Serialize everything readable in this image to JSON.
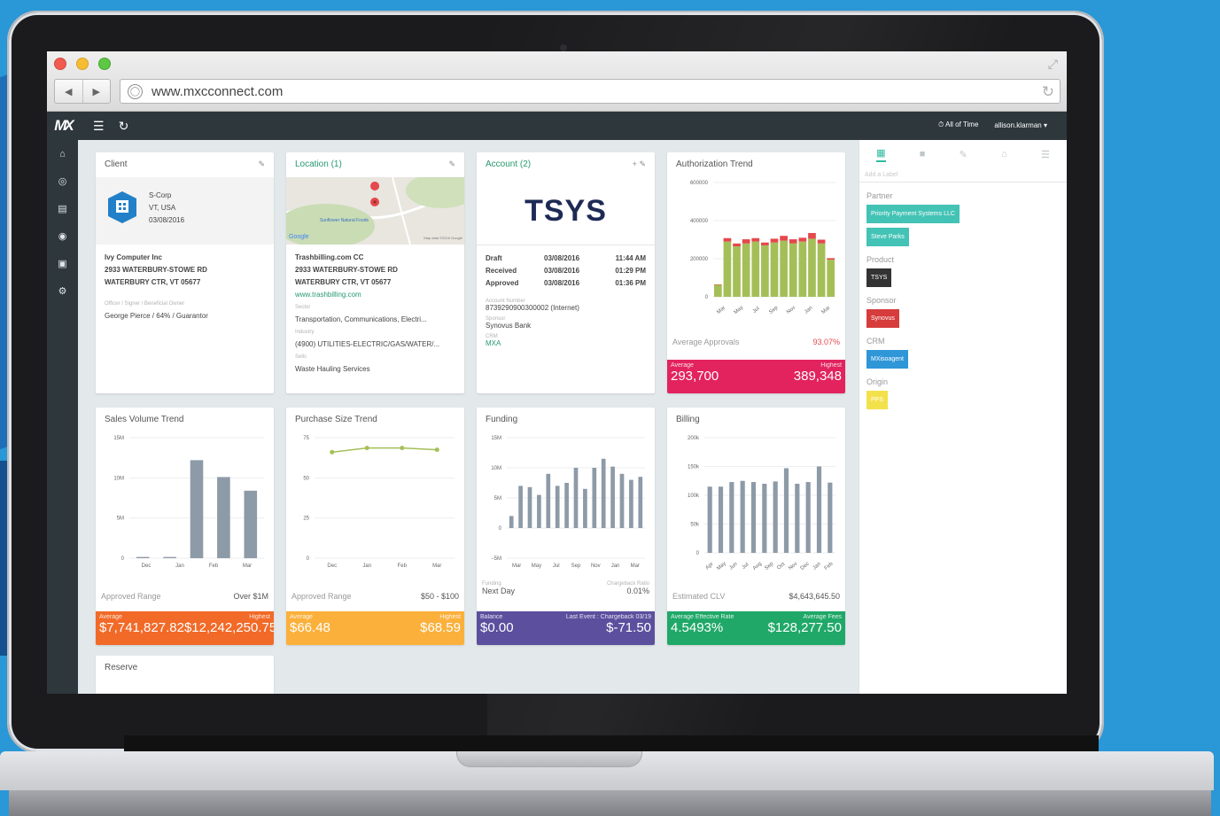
{
  "browser": {
    "url": "www.mxcconnect.com"
  },
  "topbar": {
    "logo": "MX",
    "time_filter": "All of Time",
    "user": "allison.klarman"
  },
  "client": {
    "title": "Client",
    "entity_type": "S-Corp",
    "state": "VT, USA",
    "date": "03/08/2016",
    "company": "Ivy Computer Inc",
    "address1": "2933 WATERBURY-STOWE RD",
    "address2": "WATERBURY CTR, VT 05677",
    "officer_label": "Officer / Signer / Beneficial Owner",
    "officer_value": "George Pierce / 64% / Guarantor"
  },
  "location": {
    "title": "Location (1)",
    "map_place": "Sunflower Natural Foods",
    "map_brand": "Google",
    "map_credit": "Map data ©2016 Google",
    "name": "Trashbilling.com CC",
    "address1": "2933 WATERBURY-STOWE RD",
    "address2": "WATERBURY CTR, VT 05677",
    "website": "www.trashbilling.com",
    "sector_label": "Sector",
    "sector": "Transportation, Communications, Electri...",
    "industry_label": "Industry",
    "industry": "(4900) UTILITIES-ELECTRIC/GAS/WATER/...",
    "sells_label": "Sells",
    "sells": "Waste Hauling Services"
  },
  "account": {
    "title": "Account (2)",
    "brand": "TSYS",
    "rows": [
      {
        "status": "Draft",
        "date": "03/08/2016",
        "time": "11:44 AM"
      },
      {
        "status": "Received",
        "date": "03/08/2016",
        "time": "01:29 PM"
      },
      {
        "status": "Approved",
        "date": "03/08/2016",
        "time": "01:36 PM"
      }
    ],
    "acct_label": "Account Number",
    "acct": "8739290900300002 (Internet)",
    "sponsor_label": "Sponsor",
    "sponsor": "Synovus Bank",
    "crm_label": "CRM",
    "crm": "MXA"
  },
  "auth": {
    "title": "Authorization Trend",
    "stat_label": "Average Approvals",
    "stat_value": "93.07%",
    "avg_label": "Average",
    "avg": "293,700",
    "high_label": "Highest",
    "high": "389,348"
  },
  "sales": {
    "title": "Sales Volume Trend",
    "stat_label": "Approved Range",
    "stat_value": "Over $1M",
    "avg_label": "Average",
    "avg": "$7,741,827.82",
    "high_label": "Highest",
    "high": "$12,242,250.75"
  },
  "purchase": {
    "title": "Purchase Size Trend",
    "stat_label": "Approved Range",
    "stat_value": "$50 - $100",
    "avg_label": "Average",
    "avg": "$66.48",
    "high_label": "Highest",
    "high": "$68.59"
  },
  "funding": {
    "title": "Funding",
    "funding_label": "Funding",
    "funding_value": "Next Day",
    "cb_label": "Chargeback Ratio",
    "cb_value": "0.01%",
    "balance_label": "Balance",
    "balance": "$0.00",
    "event_label": "Last Event : Chargeback 03/19",
    "event": "$-71.50"
  },
  "billing": {
    "title": "Billing",
    "stat_label": "Estimated CLV",
    "stat_value": "$4,643,645.50",
    "rate_label": "Average Effective Rate",
    "rate": "4.5493%",
    "fees_label": "Average Fees",
    "fees": "$128,277.50"
  },
  "reserve": {
    "title": "Reserve"
  },
  "right_panel": {
    "add_label": "Add a Label",
    "sections": [
      {
        "title": "Partner",
        "tags": [
          "Priority Payment Systems LLC",
          "Steve Parks"
        ]
      },
      {
        "title": "Product",
        "tags": [
          "TSYS"
        ]
      },
      {
        "title": "Sponsor",
        "tags": [
          "Synovus"
        ]
      },
      {
        "title": "CRM",
        "tags": [
          "MXisoagent"
        ]
      },
      {
        "title": "Origin",
        "tags": [
          "PPS"
        ]
      }
    ]
  },
  "colors": {
    "accent_green": "#26996f",
    "auth_footer": "#e2235e",
    "sales_footer": "#f16a28",
    "purchase_footer": "#fbb03b",
    "funding_footer": "#5b4f9e",
    "billing_footer": "#20a868",
    "bar_grey": "#8d9aa7",
    "bar_green": "#a4bf58",
    "bar_red": "#e5484d"
  },
  "chart_data": [
    {
      "type": "bar",
      "title": "Authorization Trend",
      "categories": [
        "Mar",
        "Apr",
        "May",
        "Jun",
        "Jul",
        "Aug",
        "Sep",
        "Oct",
        "Nov",
        "Dec",
        "Jan",
        "Feb",
        "Mar"
      ],
      "x_tick_labels": [
        "Mar",
        "May",
        "Jul",
        "Sep",
        "Nov",
        "Jan",
        "Mar"
      ],
      "series": [
        {
          "name": "Approved",
          "values": [
            65000,
            290000,
            265000,
            280000,
            290000,
            270000,
            285000,
            295000,
            280000,
            290000,
            305000,
            280000,
            195000
          ]
        },
        {
          "name": "Declined",
          "values": [
            0,
            18000,
            15000,
            22000,
            18000,
            15000,
            20000,
            25000,
            22000,
            20000,
            30000,
            20000,
            8000
          ]
        }
      ],
      "y_ticks": [
        "600000",
        "400000",
        "200000",
        "0"
      ],
      "ylim": [
        0,
        600000
      ]
    },
    {
      "type": "bar",
      "title": "Sales Volume Trend",
      "categories": [
        "Nov",
        "Dec",
        "Jan",
        "Feb",
        "Mar"
      ],
      "x_tick_labels": [
        "Dec",
        "Jan",
        "Feb",
        "Mar"
      ],
      "values": [
        150000,
        150000,
        12200000,
        10100000,
        8400000
      ],
      "y_ticks": [
        "15M",
        "10M",
        "5M",
        "0"
      ],
      "ylim": [
        0,
        15000000
      ]
    },
    {
      "type": "line",
      "title": "Purchase Size Trend",
      "categories": [
        "Dec",
        "Jan",
        "Feb",
        "Mar"
      ],
      "values": [
        66,
        68.6,
        68.6,
        67.5
      ],
      "y_ticks": [
        "75",
        "50",
        "25",
        "0"
      ],
      "ylim": [
        0,
        75
      ]
    },
    {
      "type": "bar",
      "title": "Funding",
      "categories": [
        "Mar",
        "Apr",
        "May",
        "Jun",
        "Jul",
        "Aug",
        "Sep",
        "Oct",
        "Nov",
        "Dec",
        "Jan",
        "Feb",
        "Mar",
        "Apr",
        "Mar"
      ],
      "x_tick_labels": [
        "Mar",
        "May",
        "Jul",
        "Sep",
        "Nov",
        "Jan",
        "Mar"
      ],
      "values": [
        2000000,
        7000000,
        6800000,
        5500000,
        9000000,
        7000000,
        7500000,
        10000000,
        6500000,
        10000000,
        11500000,
        10200000,
        9000000,
        8000000,
        8500000
      ],
      "y_ticks": [
        "15M",
        "10M",
        "5M",
        "0",
        "−5M"
      ],
      "ylim": [
        -5000000,
        15000000
      ]
    },
    {
      "type": "bar",
      "title": "Billing",
      "categories": [
        "Apr",
        "May",
        "Jun",
        "Jul",
        "Aug",
        "Sep",
        "Oct",
        "Nov",
        "Dec",
        "Jan",
        "Feb",
        "Feb"
      ],
      "x_tick_labels": [
        "Apr",
        "May",
        "Jun",
        "Jul",
        "Aug",
        "Sep",
        "Oct",
        "Nov",
        "Dec",
        "Jan",
        "Feb"
      ],
      "values": [
        115000,
        115000,
        123000,
        125000,
        123000,
        120000,
        124000,
        147000,
        120000,
        123000,
        150000,
        122000
      ],
      "y_ticks": [
        "200k",
        "150k",
        "100k",
        "50k",
        "0"
      ],
      "ylim": [
        0,
        200000
      ]
    }
  ]
}
